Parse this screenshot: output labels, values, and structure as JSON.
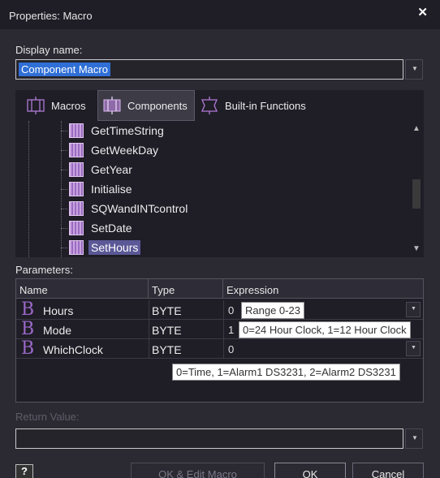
{
  "window": {
    "title": "Properties: Macro",
    "close_glyph": "✕"
  },
  "display": {
    "label": "Display name:",
    "value": "Component Macro"
  },
  "tabs": [
    {
      "label": "Macros",
      "icon": "macros-icon"
    },
    {
      "label": "Components",
      "icon": "components-icon",
      "active": true
    },
    {
      "label": "Built-in Functions",
      "icon": "builtin-functions-icon"
    }
  ],
  "tree": {
    "items": [
      {
        "label": "GetTimeString"
      },
      {
        "label": "GetWeekDay"
      },
      {
        "label": "GetYear"
      },
      {
        "label": "Initialise"
      },
      {
        "label": "SQWandINTcontrol"
      },
      {
        "label": "SetDate"
      },
      {
        "label": "SetHours",
        "selected": true
      }
    ]
  },
  "parameters": {
    "label": "Parameters:",
    "headers": {
      "name": "Name",
      "type": "Type",
      "expression": "Expression"
    },
    "rows": [
      {
        "name": "Hours",
        "type": "BYTE",
        "expression": "0",
        "tip": "Range 0-23"
      },
      {
        "name": "Mode",
        "type": "BYTE",
        "expression": "1",
        "tip": "0=24 Hour Clock, 1=12 Hour Clock"
      },
      {
        "name": "WhichClock",
        "type": "BYTE",
        "expression": "0",
        "tip": "0=Time, 1=Alarm1 DS3231, 2=Alarm2 DS3231"
      }
    ]
  },
  "return_value": {
    "label": "Return Value:",
    "value": ""
  },
  "buttons": {
    "help": "?",
    "ok_edit": "OK & Edit Macro",
    "ok": "OK",
    "cancel": "Cancel"
  }
}
